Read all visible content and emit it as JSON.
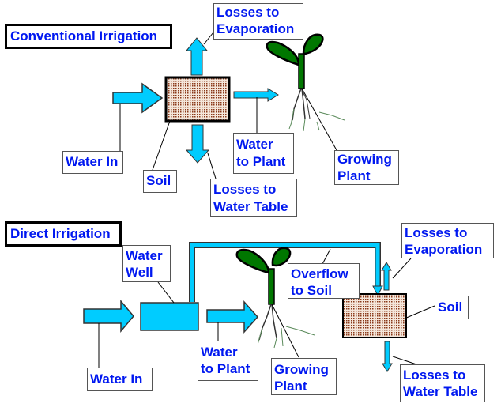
{
  "colors": {
    "water": "#00ccff",
    "soil": "#a0522d",
    "leaf": "#007700",
    "label_text": "#0018f0"
  },
  "conventional": {
    "title": "Conventional Irrigation",
    "labels": {
      "evaporation": "Losses to\nEvaporation",
      "water_in": "Water In",
      "soil": "Soil",
      "water_to_plant": "Water\nto Plant",
      "growing_plant": "Growing\nPlant",
      "water_table": "Losses to\nWater Table"
    }
  },
  "direct": {
    "title": "Direct Irrigation",
    "labels": {
      "water_well": "Water\nWell",
      "water_in": "Water In",
      "water_to_plant": "Water\nto Plant",
      "growing_plant": "Growing\nPlant",
      "overflow": "Overflow\nto Soil",
      "evaporation": "Losses to\nEvaporation",
      "soil": "Soil",
      "water_table": "Losses to\nWater Table"
    }
  }
}
